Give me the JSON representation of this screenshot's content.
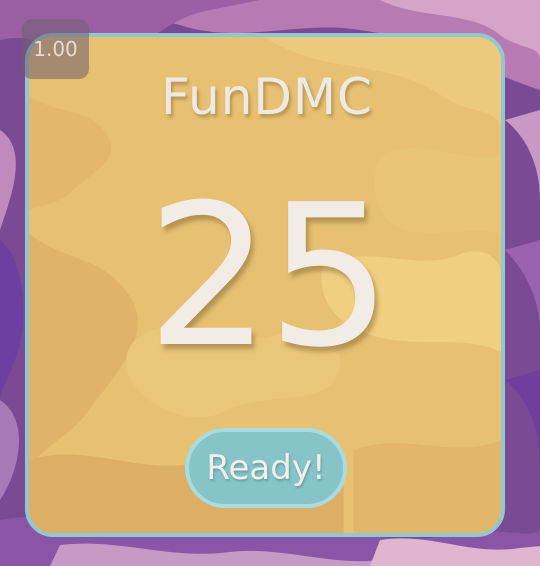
{
  "version_label": "1.00",
  "title": "FunDMC",
  "countdown": "25",
  "ready_button_label": "Ready!",
  "colors": {
    "card_fill": "#e6be70",
    "card_border": "#8fc9cf",
    "button_fill": "#86c4ca",
    "text": "#f1ece6",
    "background": "#7d4a94"
  }
}
